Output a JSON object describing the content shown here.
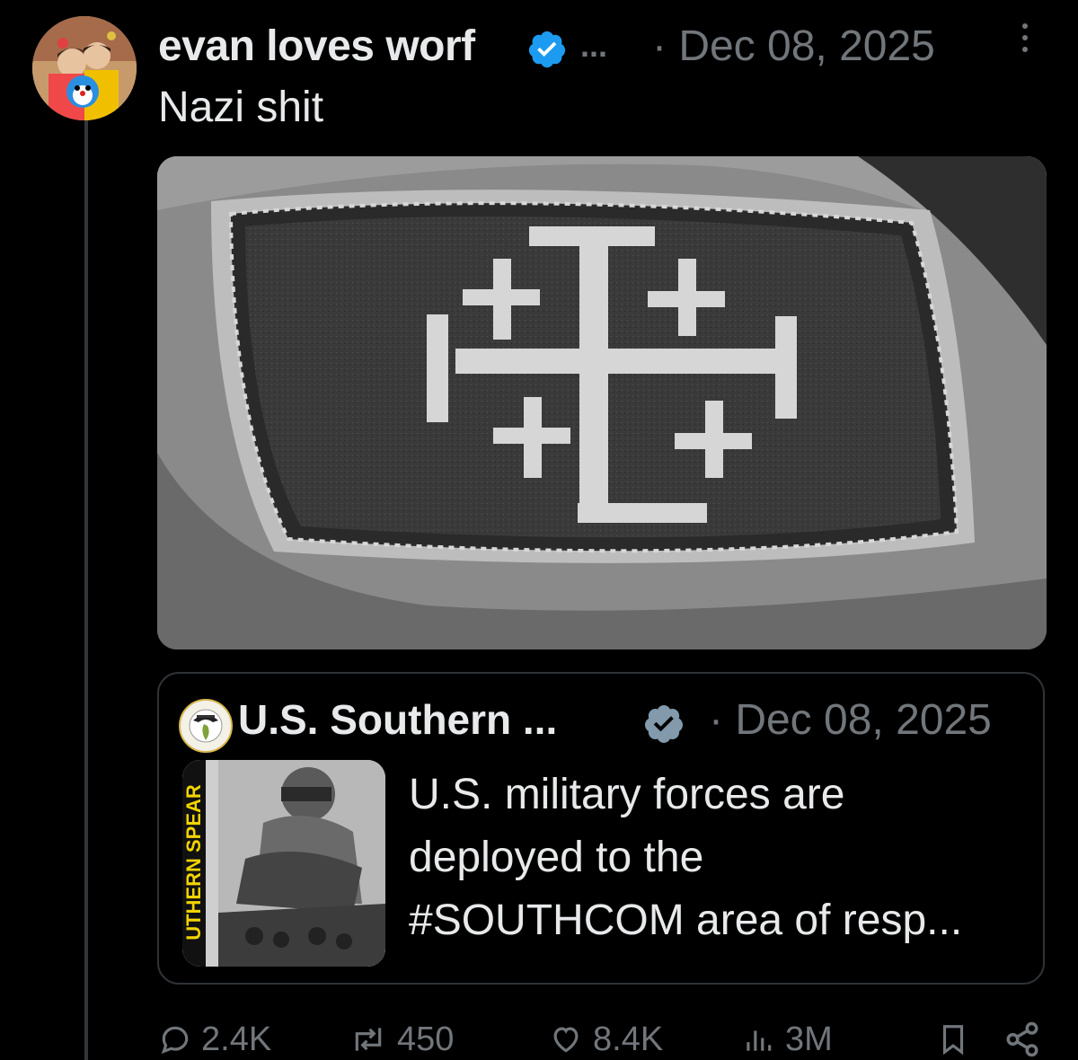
{
  "tweet": {
    "author_name": "evan loves worf",
    "name_overflow": "...",
    "date": "· Dec 08, 2025",
    "text": "Nazi shit",
    "avatar_icon": "profile-photo-icon",
    "verified_icon": "verified-badge-icon",
    "more_icon": "more-options-icon"
  },
  "quoted": {
    "author_name": "U.S. Southern ...",
    "date": "· Dec 08, 2025",
    "text_lines": [
      "U.S. military forces are",
      "deployed to the",
      "#SOUTHCOM area of resp..."
    ],
    "thumb_banner": "UTHERN SPEAR"
  },
  "actions": {
    "replies": "2.4K",
    "reposts": "450",
    "likes": "8.4K",
    "views": "3M"
  },
  "colors": {
    "background": "#000000",
    "text_primary": "#e7e9ea",
    "text_secondary": "#71767b",
    "verified_blue": "#1d9bf0",
    "verified_gray": "#829aab",
    "border": "#2f3336"
  }
}
